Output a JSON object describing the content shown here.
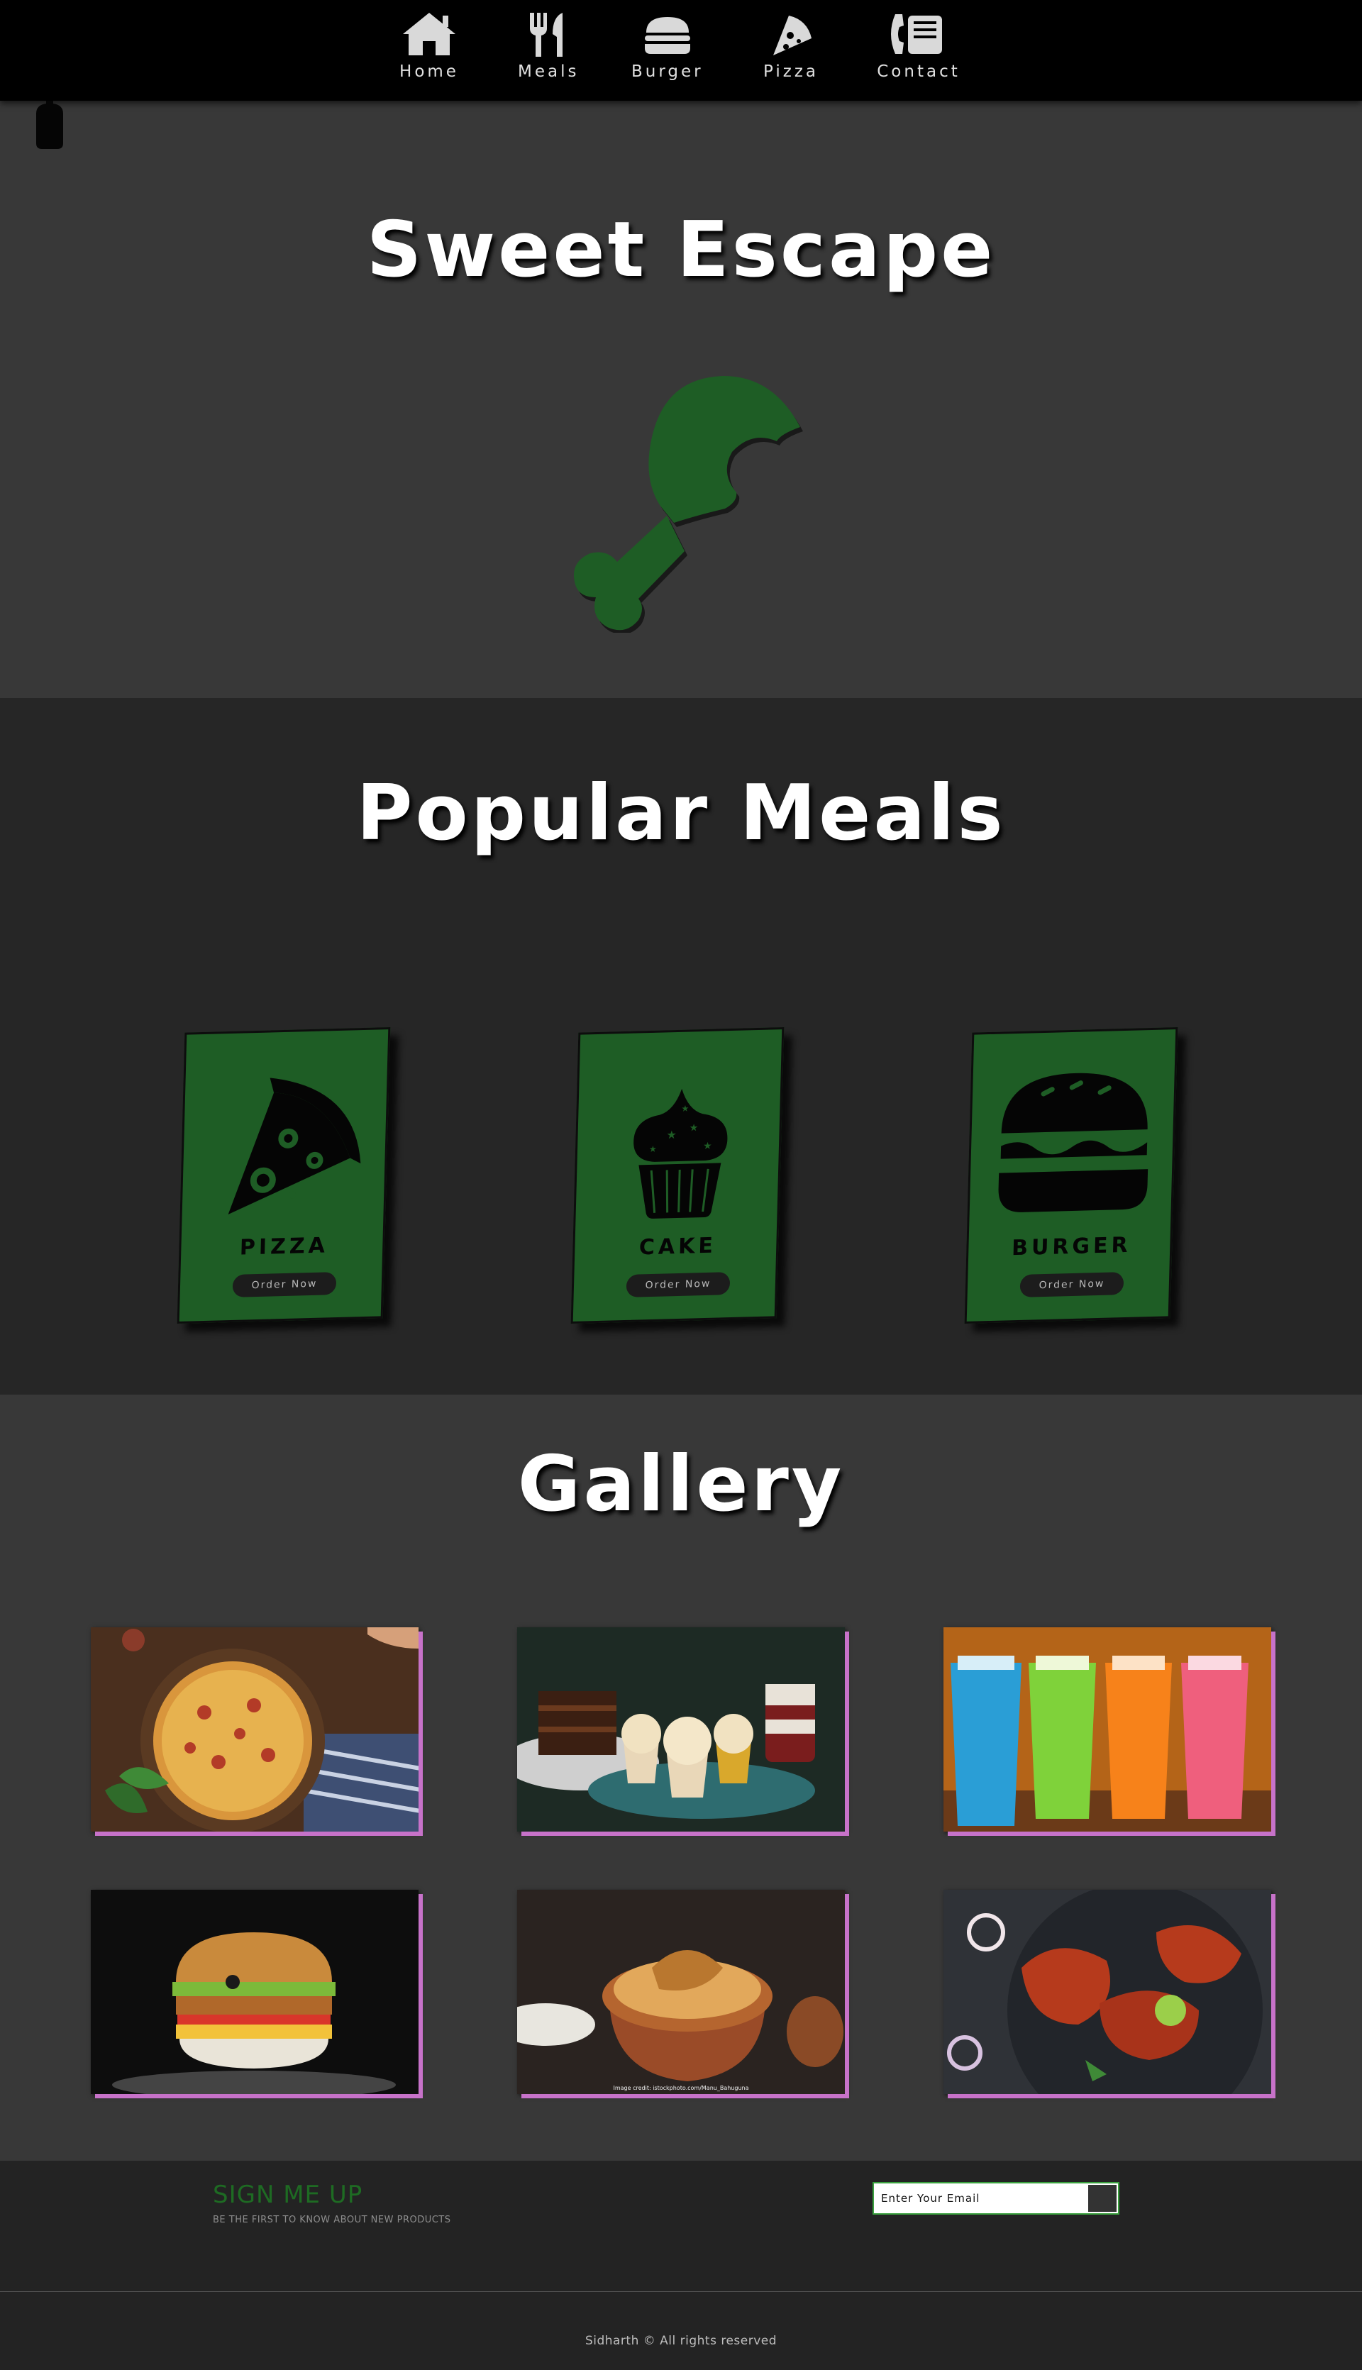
{
  "nav": {
    "items": [
      {
        "label": "Home",
        "icon": "home-icon"
      },
      {
        "label": "Meals",
        "icon": "utensils-icon"
      },
      {
        "label": "Burger",
        "icon": "burger-icon"
      },
      {
        "label": "Pizza",
        "icon": "pizza-icon"
      },
      {
        "label": "Contact",
        "icon": "phone-icon"
      }
    ]
  },
  "hero": {
    "title": "Sweet Escape",
    "icon": "drumstick-icon"
  },
  "meals": {
    "title": "Popular Meals",
    "cards": [
      {
        "name": "PIZZA",
        "button": "Order Now",
        "icon": "pizza-slice-icon"
      },
      {
        "name": "CAKE",
        "button": "Order Now",
        "icon": "cupcake-icon"
      },
      {
        "name": "BURGER",
        "button": "Order Now",
        "icon": "hamburger-icon"
      }
    ]
  },
  "gallery": {
    "title": "Gallery",
    "images": [
      {
        "name": "pizza-photo"
      },
      {
        "name": "desserts-photo"
      },
      {
        "name": "drinks-photo"
      },
      {
        "name": "burger-photo"
      },
      {
        "name": "biryani-photo",
        "credit": "Image credit: istockphoto.com/Manu_Bahuguna"
      },
      {
        "name": "tandoori-chicken-photo"
      }
    ]
  },
  "footer": {
    "signup_title": "SIGN ME UP",
    "signup_subtitle": "BE THE FIRST TO KNOW ABOUT NEW PRODUCTS",
    "email_placeholder": "Enter Your Email",
    "copyright": "Sidharth © All rights reserved"
  },
  "colors": {
    "accent_green": "#1e5d25",
    "nav_bg": "#000000",
    "hero_bg": "#383838",
    "meals_bg": "#262626",
    "gallery_shadow": "#c772c9"
  }
}
